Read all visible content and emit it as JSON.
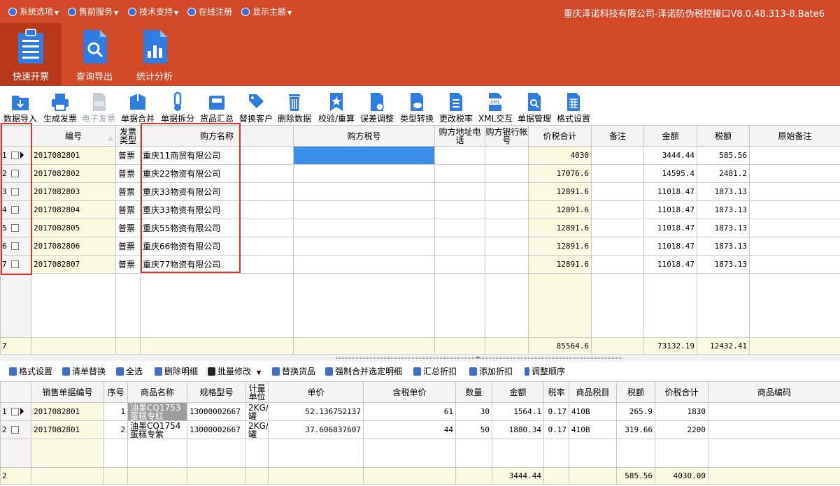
{
  "menu": {
    "items": [
      {
        "label": "系统选项",
        "icon": "settings-icon"
      },
      {
        "label": "售前服务",
        "icon": "service-icon"
      },
      {
        "label": "技术支持",
        "icon": "support-icon"
      },
      {
        "label": "在线注册",
        "icon": "register-icon"
      },
      {
        "label": "显示主题",
        "icon": "theme-icon"
      }
    ],
    "app_title": "重庆泽诺科技有限公司-泽诺防伪税控接口V8.0.48.313-8.Bate6"
  },
  "ribbon": {
    "buttons": [
      {
        "label": "快速开票",
        "icon": "clipboard-list-icon",
        "active": true
      },
      {
        "label": "查询导出",
        "icon": "document-search-icon",
        "active": false
      },
      {
        "label": "统计分析",
        "icon": "document-chart-icon",
        "active": false
      }
    ]
  },
  "toolbar": {
    "buttons": [
      {
        "label": "数据导入",
        "icon": "folder-import-icon",
        "disabled": false
      },
      {
        "label": "生成发票",
        "icon": "printer-icon",
        "disabled": false
      },
      {
        "label": "电子发票",
        "icon": "e-invoice-icon",
        "disabled": true
      },
      {
        "label": "单据合并",
        "icon": "merge-box-icon",
        "disabled": false
      },
      {
        "label": "单据拆分",
        "icon": "split-icon",
        "disabled": false
      },
      {
        "label": "货品汇总",
        "icon": "inbox-icon",
        "disabled": false
      },
      {
        "label": "替换客户",
        "icon": "tag-swap-icon",
        "disabled": false
      },
      {
        "label": "删除数据",
        "icon": "trash-icon",
        "disabled": false
      },
      {
        "label": "校验/重算",
        "icon": "bookmark-star-icon",
        "disabled": false
      },
      {
        "label": "误差调整",
        "icon": "document-adjust-icon",
        "disabled": false
      },
      {
        "label": "类型转换",
        "icon": "document-cloud-icon",
        "disabled": false
      },
      {
        "label": "更改税率",
        "icon": "document-list-icon",
        "disabled": false
      },
      {
        "label": "XML交互",
        "icon": "xml-icon",
        "disabled": false
      },
      {
        "label": "单据管理",
        "icon": "document-magnify-icon",
        "disabled": false
      },
      {
        "label": "格式设置",
        "icon": "grid-settings-icon",
        "disabled": false
      }
    ]
  },
  "invoice_grid": {
    "headers": [
      "编号",
      "发票类型",
      "购方名称",
      "购方税号",
      "购方地址电话",
      "购方银行帐号",
      "价税合计",
      "备注",
      "金额",
      "税额",
      "原始备注"
    ],
    "rows": [
      {
        "row_no": "1",
        "id": "2017082801",
        "type": "普票",
        "buyer": "重庆11商贸有限公司",
        "tax_id": "",
        "addr_tel": "",
        "bank": "",
        "total": "4030",
        "remark": "",
        "amount": "3444.44",
        "tax": "585.56",
        "orig_remark": ""
      },
      {
        "row_no": "2",
        "id": "2017082802",
        "type": "普票",
        "buyer": "重庆22物资有限公司",
        "tax_id": "",
        "addr_tel": "",
        "bank": "",
        "total": "17076.6",
        "remark": "",
        "amount": "14595.4",
        "tax": "2481.2",
        "orig_remark": ""
      },
      {
        "row_no": "3",
        "id": "2017082803",
        "type": "普票",
        "buyer": "重庆33物资有限公司",
        "tax_id": "",
        "addr_tel": "",
        "bank": "",
        "total": "12891.6",
        "remark": "",
        "amount": "11018.47",
        "tax": "1873.13",
        "orig_remark": ""
      },
      {
        "row_no": "4",
        "id": "2017082804",
        "type": "普票",
        "buyer": "重庆33物资有限公司",
        "tax_id": "",
        "addr_tel": "",
        "bank": "",
        "total": "12891.6",
        "remark": "",
        "amount": "11018.47",
        "tax": "1873.13",
        "orig_remark": ""
      },
      {
        "row_no": "5",
        "id": "2017082805",
        "type": "普票",
        "buyer": "重庆55物资有限公司",
        "tax_id": "",
        "addr_tel": "",
        "bank": "",
        "total": "12891.6",
        "remark": "",
        "amount": "11018.47",
        "tax": "1873.13",
        "orig_remark": ""
      },
      {
        "row_no": "6",
        "id": "2017082806",
        "type": "普票",
        "buyer": "重庆66物资有限公司",
        "tax_id": "",
        "addr_tel": "",
        "bank": "",
        "total": "12891.6",
        "remark": "",
        "amount": "11018.47",
        "tax": "1873.13",
        "orig_remark": ""
      },
      {
        "row_no": "7",
        "id": "2017082807",
        "type": "普票",
        "buyer": "重庆77物资有限公司",
        "tax_id": "",
        "addr_tel": "",
        "bank": "",
        "total": "12891.6",
        "remark": "",
        "amount": "11018.47",
        "tax": "1873.13",
        "orig_remark": ""
      }
    ],
    "footer": {
      "count": "7",
      "total": "85564.6",
      "amount": "73132.19",
      "tax": "12432.41"
    }
  },
  "detail_toolbar": {
    "buttons": [
      {
        "label": "格式设置",
        "icon": "format-icon",
        "color": "#3f6fc6"
      },
      {
        "label": "清单替换",
        "icon": "replace-icon",
        "color": "#3f6fc6"
      },
      {
        "label": "全选",
        "icon": "select-all-icon",
        "color": "#3f6fc6"
      },
      {
        "label": "删除明细",
        "icon": "delete-icon",
        "color": "#3f6fc6"
      },
      {
        "label": "批量修改",
        "icon": "batch-edit-icon",
        "color": "#222222"
      },
      {
        "label": "替换货品",
        "icon": "tag-icon",
        "color": "#3f6fc6"
      },
      {
        "label": "强制合并选定明细",
        "icon": "force-merge-icon",
        "color": "#3f6fc6"
      },
      {
        "label": "汇总折扣",
        "icon": "discount-sum-icon",
        "color": "#3f6fc6"
      },
      {
        "label": "添加折扣",
        "icon": "add-discount-icon",
        "color": "#3f6fc6"
      },
      {
        "label": "调整顺序",
        "icon": "flag-icon",
        "color": "#3f6fc6"
      }
    ]
  },
  "detail_grid": {
    "headers": [
      "销售单据编号",
      "序号",
      "商品名称",
      "规格型号",
      "计量单位",
      "单价",
      "含税单价",
      "数量",
      "金额",
      "税率",
      "商品税目",
      "税额",
      "价税合计",
      "商品编码"
    ],
    "rows": [
      {
        "row_no": "1",
        "doc_id": "2017082801",
        "seq": "1",
        "name": "油墨CQ1753蛋糕专红",
        "spec": "13000002667",
        "unit": "2KG/罐",
        "price": "52.136752137",
        "price_tax": "61",
        "qty": "30",
        "amount": "1564.1",
        "rate": "0.17",
        "tax_item": "410B",
        "tax": "265.9",
        "total": "1830",
        "code": ""
      },
      {
        "row_no": "2",
        "doc_id": "2017082801",
        "seq": "2",
        "name": "油墨CQ1754蛋糕专紫",
        "spec": "13000002667",
        "unit": "2KG/罐",
        "price": "37.606837607",
        "price_tax": "44",
        "qty": "50",
        "amount": "1880.34",
        "rate": "0.17",
        "tax_item": "410B",
        "tax": "319.66",
        "total": "2200",
        "code": ""
      }
    ],
    "footer": {
      "count": "2",
      "amount": "3444.44",
      "tax": "585.56",
      "total": "4030.00"
    }
  },
  "colors": {
    "brand": "#d34a28",
    "brand_active": "#b7391a",
    "selection": "#3a8ee6",
    "highlight_col": "#fbfbe4",
    "annotation": "#e0312a"
  }
}
